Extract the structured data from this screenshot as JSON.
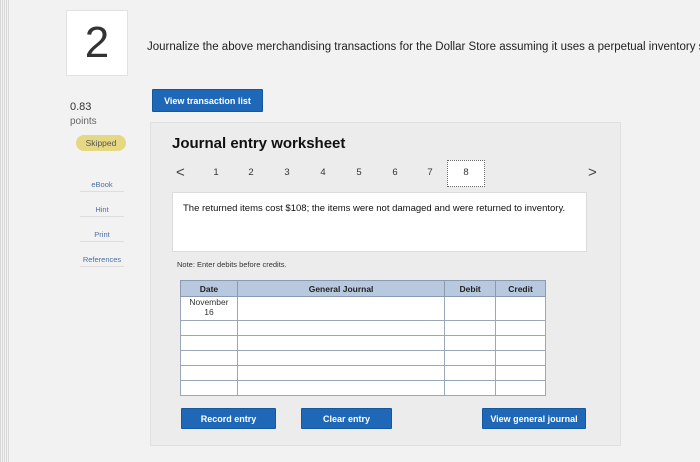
{
  "question": {
    "number": "2",
    "prompt": "Journalize the above merchandising transactions for the Dollar Store assuming it uses a perpetual inventory system method.",
    "points_value": "0.83",
    "points_label": "points",
    "status": "Skipped"
  },
  "side_links": [
    "eBook",
    "Hint",
    "Print",
    "References"
  ],
  "view_transaction_label": "View transaction list",
  "worksheet": {
    "title": "Journal entry worksheet",
    "pages": [
      "1",
      "2",
      "3",
      "4",
      "5",
      "6",
      "7",
      "8"
    ],
    "active_page": "8",
    "prev_symbol": "<",
    "next_symbol": ">",
    "description": "The returned items cost $108; the items were not damaged and were returned to inventory.",
    "note": "Note: Enter debits before credits."
  },
  "journal": {
    "headers": {
      "date": "Date",
      "general_journal": "General Journal",
      "debit": "Debit",
      "credit": "Credit"
    },
    "date_month": "November",
    "date_day": "16"
  },
  "buttons": {
    "record": "Record entry",
    "clear": "Clear entry",
    "view_journal": "View general journal"
  }
}
